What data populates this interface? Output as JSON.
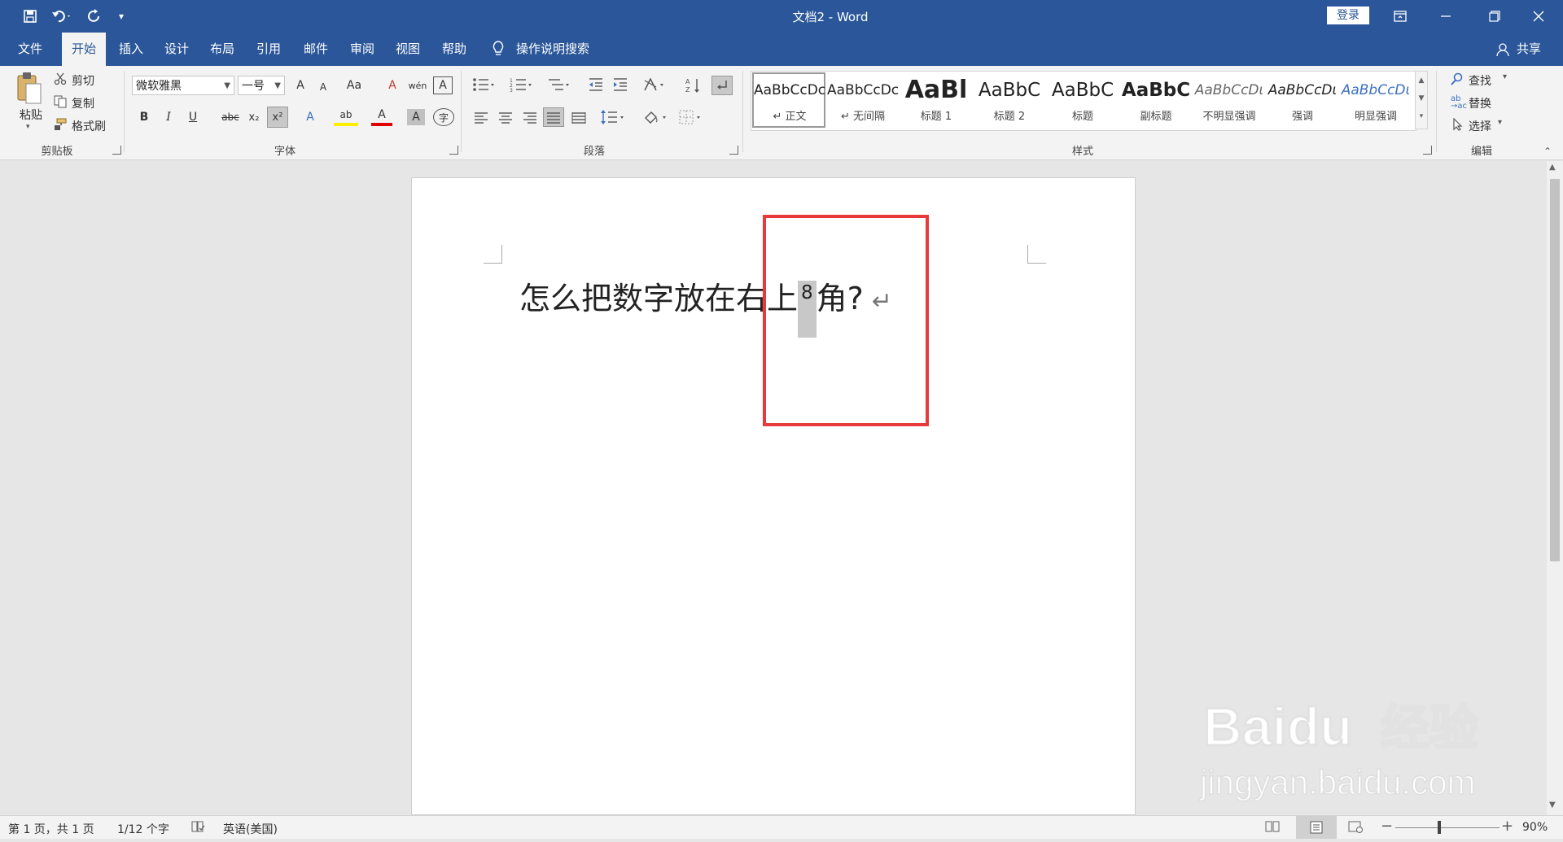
{
  "window": {
    "title": "文档2  -  Word",
    "login_label": "登录"
  },
  "tabs": [
    {
      "label": "文件"
    },
    {
      "label": "开始"
    },
    {
      "label": "插入"
    },
    {
      "label": "设计"
    },
    {
      "label": "布局"
    },
    {
      "label": "引用"
    },
    {
      "label": "邮件"
    },
    {
      "label": "审阅"
    },
    {
      "label": "视图"
    },
    {
      "label": "帮助"
    }
  ],
  "tell_me": {
    "label": "操作说明搜索"
  },
  "share": {
    "label": "共享"
  },
  "clipboard": {
    "paste_label": "粘贴",
    "cut_label": "剪切",
    "copy_label": "复制",
    "format_painter_label": "格式刷",
    "group_label": "剪贴板"
  },
  "font": {
    "font_name": "微软雅黑",
    "font_size": "一号",
    "group_label": "字体",
    "buttons": {
      "bold": "B",
      "italic": "I",
      "underline": "U",
      "strikethrough": "abc",
      "subscript": "x₂",
      "superscript": "x²",
      "grow": "A",
      "shrink": "A",
      "case": "Aa",
      "font_color": "A",
      "char_shading": "A",
      "pinyin": "wén",
      "char_border": "A",
      "clear_format": "A",
      "highlight": "ab",
      "text_effects": "A",
      "enclose": "字"
    }
  },
  "paragraph": {
    "group_label": "段落"
  },
  "styles": {
    "group_label": "样式",
    "items": [
      {
        "sample": "AaBbCcDc",
        "name": "↵ 正文"
      },
      {
        "sample": "AaBbCcDc",
        "name": "↵ 无间隔"
      },
      {
        "sample": "AaBl",
        "name": "标题 1"
      },
      {
        "sample": "AaBbC",
        "name": "标题 2"
      },
      {
        "sample": "AaBbC",
        "name": "标题"
      },
      {
        "sample": "AaBbC",
        "name": "副标题"
      },
      {
        "sample": "AaBbCcDι",
        "name": "不明显强调"
      },
      {
        "sample": "AaBbCcDι",
        "name": "强调"
      },
      {
        "sample": "AaBbCcDι",
        "name": "明显强调"
      }
    ]
  },
  "editing": {
    "find_label": "查找",
    "replace_label": "替换",
    "select_label": "选择",
    "group_label": "编辑"
  },
  "document": {
    "text_before": "怎么把数字放在右上",
    "superscript_char": "8",
    "text_after": "角?",
    "paragraph_mark": "↵"
  },
  "status": {
    "page_info": "第 1 页，共 1 页",
    "word_count": "1/12 个字",
    "language": "英语(美国)",
    "zoom": "90%"
  },
  "watermark": {
    "brand": "Baidu经验",
    "url": "jingyan.baidu.com"
  },
  "colors": {
    "title_bar": "#2b579a",
    "highlight_box": "#e83a3a",
    "selection_gray": "#c8c8c8"
  }
}
